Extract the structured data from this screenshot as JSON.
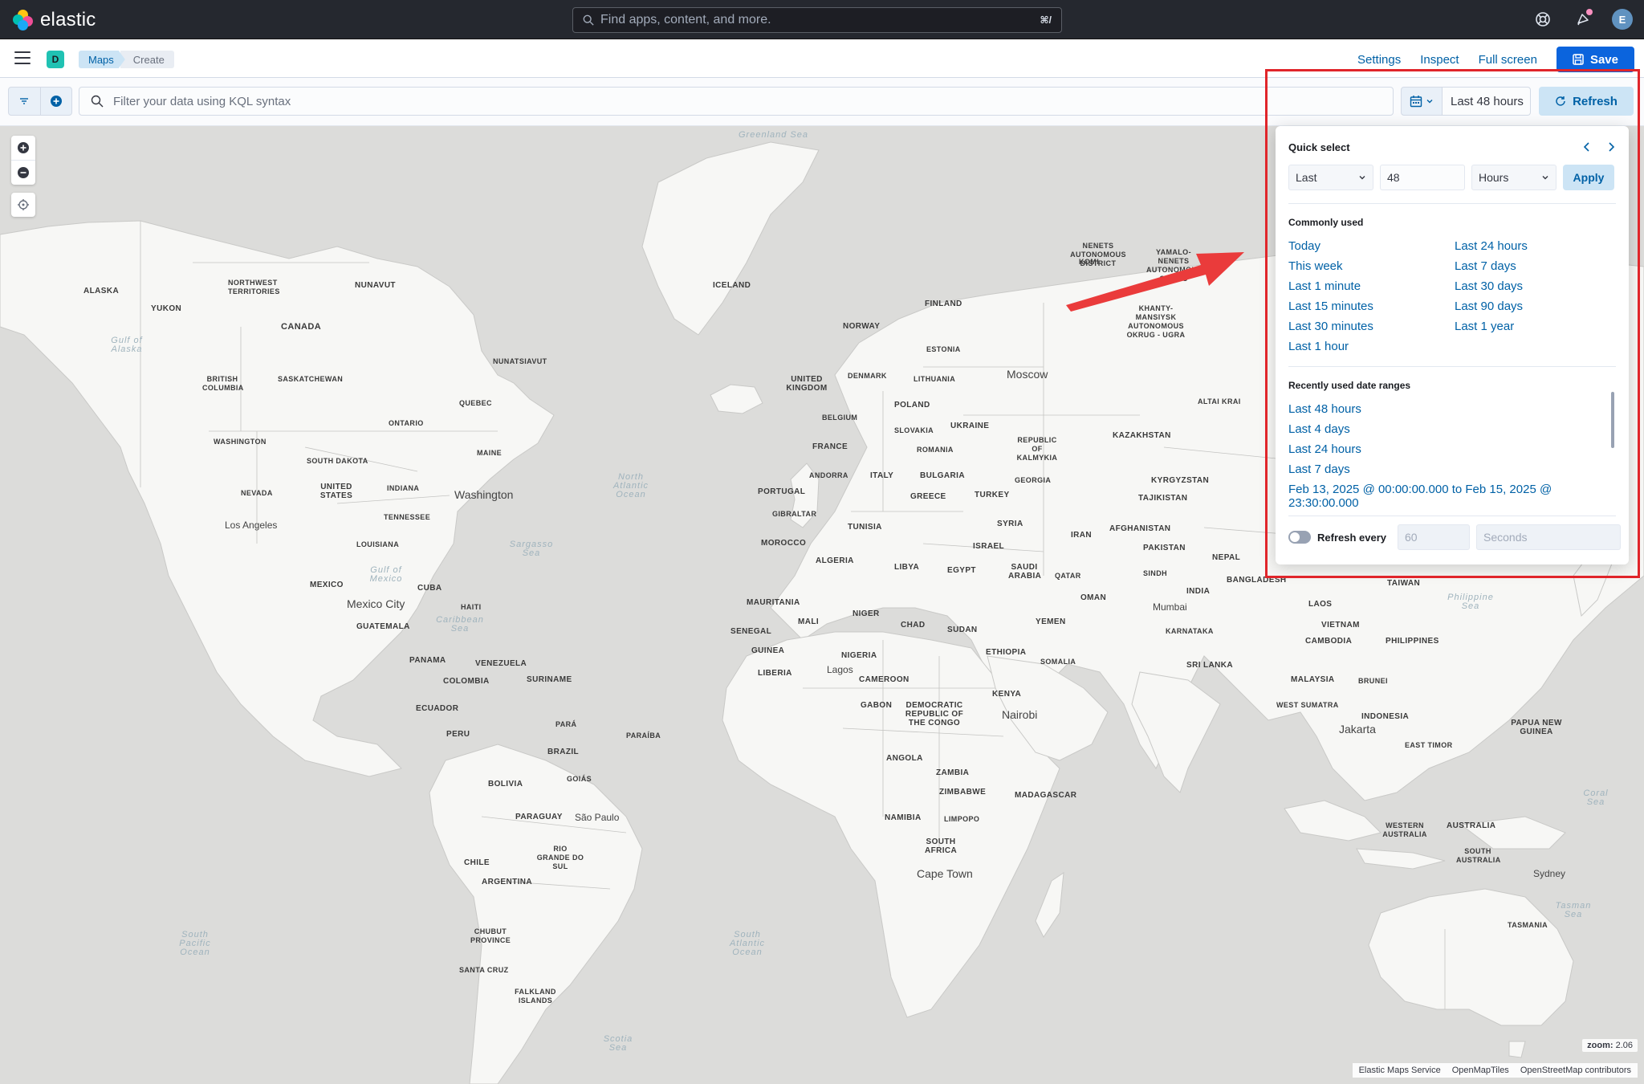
{
  "header": {
    "brand": "elastic",
    "search_placeholder": "Find apps, content, and more.",
    "search_shortcut": "⌘/",
    "avatar_initial": "E"
  },
  "nav": {
    "space_initial": "D",
    "breadcrumbs": [
      "Maps",
      "Create"
    ],
    "settings_label": "Settings",
    "inspect_label": "Inspect",
    "fullscreen_label": "Full screen",
    "save_label": "Save"
  },
  "query": {
    "placeholder": "Filter your data using KQL syntax",
    "date_label": "Last 48 hours",
    "refresh_label": "Refresh"
  },
  "quick_select": {
    "title": "Quick select",
    "tense": "Last",
    "value": "48",
    "unit": "Hours",
    "apply_label": "Apply",
    "commonly_used_title": "Commonly used",
    "commonly_used_left": [
      "Today",
      "This week",
      "Last 1 minute",
      "Last 15 minutes",
      "Last 30 minutes",
      "Last 1 hour"
    ],
    "commonly_used_right": [
      "Last 24 hours",
      "Last 7 days",
      "Last 30 days",
      "Last 90 days",
      "Last 1 year"
    ],
    "recent_title": "Recently used date ranges",
    "recent": [
      "Last 48 hours",
      "Last 4 days",
      "Last 24 hours",
      "Last 7 days",
      "Feb 13, 2025 @ 00:00:00.000 to Feb 15, 2025 @ 23:30:00.000"
    ],
    "refresh_every_label": "Refresh every",
    "refresh_interval": "60",
    "refresh_unit": "Seconds",
    "refresh_enabled": false
  },
  "map": {
    "zoom_label": "zoom:",
    "zoom_value": "2.06",
    "attribution": [
      "Elastic Maps Service",
      "OpenMapTiles",
      "OpenStreetMap contributors"
    ],
    "labels": {
      "greenland_sea": "Greenland Sea",
      "iceland": "ICELAND",
      "alaska": "ALASKA",
      "yukon": "YUKON",
      "nwt": "NORTHWEST TERRITORIES",
      "nunavut": "NUNAVUT",
      "canada": "CANADA",
      "gulf_alaska": "Gulf of Alaska",
      "bc": "BRITISH COLUMBIA",
      "saskatchewan": "SASKATCHEWAN",
      "nunatsiavut": "NUNATSIAVUT",
      "quebec": "QUEBEC",
      "ontario": "ONTARIO",
      "maine": "MAINE",
      "washington_state": "WASHINGTON",
      "south_dakota": "SOUTH DAKOTA",
      "nevada": "NEVADA",
      "united_states": "UNITED STATES",
      "indiana": "INDIANA",
      "washington_city": "Washington",
      "tennessee": "TENNESSEE",
      "los_angeles": "Los Angeles",
      "louisiana": "LOUISIANA",
      "north_atlantic": "North Atlantic Ocean",
      "sargasso": "Sargasso Sea",
      "gulf_mexico": "Gulf of Mexico",
      "mexico": "MEXICO",
      "cuba": "CUBA",
      "mexico_city": "Mexico City",
      "haiti": "HAITI",
      "guatemala": "GUATEMALA",
      "caribbean": "Caribbean Sea",
      "panama": "PANAMA",
      "venezuela": "VENEZUELA",
      "colombia": "COLOMBIA",
      "suriname": "SURINAME",
      "ecuador": "ECUADOR",
      "para": "PARÁ",
      "paraiba": "PARAÍBA",
      "peru": "PERU",
      "brazil": "BRAZIL",
      "bolivia": "BOLIVIA",
      "goias": "GOIÁS",
      "paraguay": "PARAGUAY",
      "sao_paulo": "São Paulo",
      "rio_grande": "RIO GRANDE DO SUL",
      "chile": "CHILE",
      "argentina": "ARGENTINA",
      "chubut": "CHUBUT PROVINCE",
      "santa_cruz": "SANTA CRUZ",
      "falkland": "FALKLAND ISLANDS",
      "south_pacific": "South Pacific Ocean",
      "south_atlantic": "South Atlantic Ocean",
      "scotia": "Scotia Sea",
      "finland": "FINLAND",
      "norway": "NORWAY",
      "estonia": "ESTONIA",
      "uk": "UNITED KINGDOM",
      "denmark": "DENMARK",
      "lithuania": "LITHUANIA",
      "moscow": "Moscow",
      "poland": "POLAND",
      "belgium": "BELGIUM",
      "ukraine": "UKRAINE",
      "slovakia": "SLOVAKIA",
      "france": "FRANCE",
      "romania": "ROMANIA",
      "kalmykia": "REPUBLIC OF KALMYKIA",
      "andorra": "ANDORRA",
      "italy": "ITALY",
      "bulgaria": "BULGARIA",
      "georgia": "GEORGIA",
      "portugal": "PORTUGAL",
      "greece": "GREECE",
      "turkey": "TURKEY",
      "gibraltar": "GIBRALTAR",
      "tunisia": "TUNISIA",
      "syria": "SYRIA",
      "morocco": "MOROCCO",
      "israel": "ISRAEL",
      "algeria": "ALGERIA",
      "libya": "LIBYA",
      "egypt": "EGYPT",
      "saudi": "SAUDI ARABIA",
      "qatar": "QATAR",
      "mauritania": "MAURITANIA",
      "mali": "MALI",
      "niger": "NIGER",
      "chad": "CHAD",
      "sudan": "SUDAN",
      "yemen": "YEMEN",
      "oman": "OMAN",
      "senegal": "SENEGAL",
      "guinea": "GUINEA",
      "nigeria": "NIGERIA",
      "ethiopia": "ETHIOPIA",
      "somalia": "SOMALIA",
      "liberia": "LIBERIA",
      "lagos": "Lagos",
      "cameroon": "CAMEROON",
      "kenya": "KENYA",
      "gabon": "GABON",
      "drc": "DEMOCRATIC REPUBLIC OF THE CONGO",
      "nairobi": "Nairobi",
      "angola": "ANGOLA",
      "zambia": "ZAMBIA",
      "zimbabwe": "ZIMBABWE",
      "madagascar": "MADAGASCAR",
      "namibia": "NAMIBIA",
      "limpopo": "LIMPOPO",
      "south_africa": "SOUTH AFRICA",
      "cape_town": "Cape Town",
      "nenets": "NENETS AUTONOMOUS DISTRICT",
      "yamalo": "YAMALO-NENETS AUTONOMOUS OKRUG",
      "komi": "KOMI",
      "khanty": "KHANTY-MANSIYSK AUTONOMOUS OKRUG - UGRA",
      "altai": "ALTAI KRAI",
      "kazakhstan": "KAZAKHSTAN",
      "kyrgyzstan": "KYRGYZSTAN",
      "tajikistan": "TAJIKISTAN",
      "iran": "IRAN",
      "afghanistan": "AFGHANISTAN",
      "pakistan": "PAKISTAN",
      "nepal": "NEPAL",
      "sindh": "SINDH",
      "bangladesh": "BANGLADESH",
      "india": "INDIA",
      "mumbai": "Mumbai",
      "karnataka": "KARNATAKA",
      "sri_lanka": "SRI LANKA",
      "taiwan": "TAIWAN",
      "laos": "LAOS",
      "vietnam": "VIETNAM",
      "philippine_sea": "Philippine Sea",
      "cambodia": "CAMBODIA",
      "philippines": "PHILIPPINES",
      "malaysia": "MALAYSIA",
      "brunei": "BRUNEI",
      "west_sumatra": "WEST SUMATRA",
      "indonesia": "INDONESIA",
      "jakarta": "Jakarta",
      "east_timor": "EAST TIMOR",
      "png": "PAPUA NEW GUINEA",
      "coral_sea": "Coral Sea",
      "western_australia": "WESTERN AUSTRALIA",
      "australia": "AUSTRALIA",
      "south_australia": "SOUTH AUSTRALIA",
      "sydney": "Sydney",
      "tasman": "Tasman Sea",
      "tasmania": "TASMANIA"
    }
  }
}
